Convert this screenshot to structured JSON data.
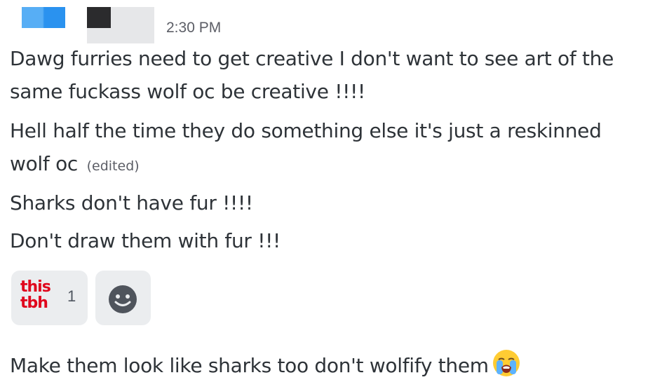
{
  "header": {
    "timestamp": "2:30 PM"
  },
  "messages": [
    {
      "text": "Dawg furries need to get creative I don't want to see art of the same fuckass wolf oc be creative !!!!"
    },
    {
      "text": "Hell half the time they do something else it's just a reskinned wolf oc",
      "edited_label": "(edited)"
    },
    {
      "text": "Sharks don't have fur !!!!"
    },
    {
      "text": "Don't draw them with fur !!!"
    },
    {
      "text": "Make them look like sharks too don't wolfify them",
      "trailing_emoji": "loudly-crying-face-icon"
    }
  ],
  "reactions": [
    {
      "emoji_line1": "this",
      "emoji_line2": "tbh",
      "emoji_color": "#e0071d",
      "count": "1"
    },
    {
      "icon": "add-reaction-smile-icon"
    }
  ],
  "colors": {
    "text": "#2e3338",
    "muted": "#5c5e66",
    "reaction_bg": "#ebedef",
    "redacted_blue": "#2a92ef"
  }
}
